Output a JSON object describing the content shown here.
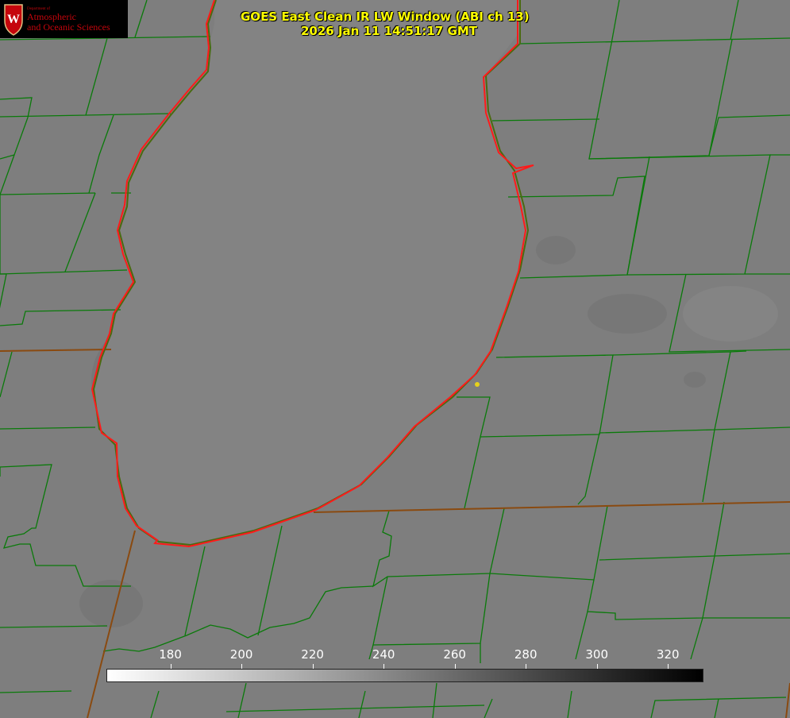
{
  "title": {
    "line1": "GOES East Clean IR LW Window (ABI ch 13)",
    "line2": "2026 Jan 11 14:51:17 GMT"
  },
  "logo": {
    "dept": "Department of",
    "line1": "Atmospheric",
    "line2": "and Oceanic Sciences",
    "crest_letter": "W"
  },
  "colorbar": {
    "min": 162,
    "max": 330,
    "ticks": [
      "180",
      "200",
      "220",
      "240",
      "260",
      "280",
      "300",
      "320"
    ],
    "tick_values": [
      180,
      200,
      220,
      240,
      260,
      280,
      300,
      320
    ],
    "colors": {
      "low": "#ffffff",
      "high": "#000000"
    }
  },
  "colors": {
    "background": "#7e7e7e",
    "county_lines": "#0a7a0a",
    "state_lines": "#8a4a10",
    "shoreline": "#ff1a1a",
    "marker": "#e6d21a",
    "title_text": "#ffff00"
  }
}
